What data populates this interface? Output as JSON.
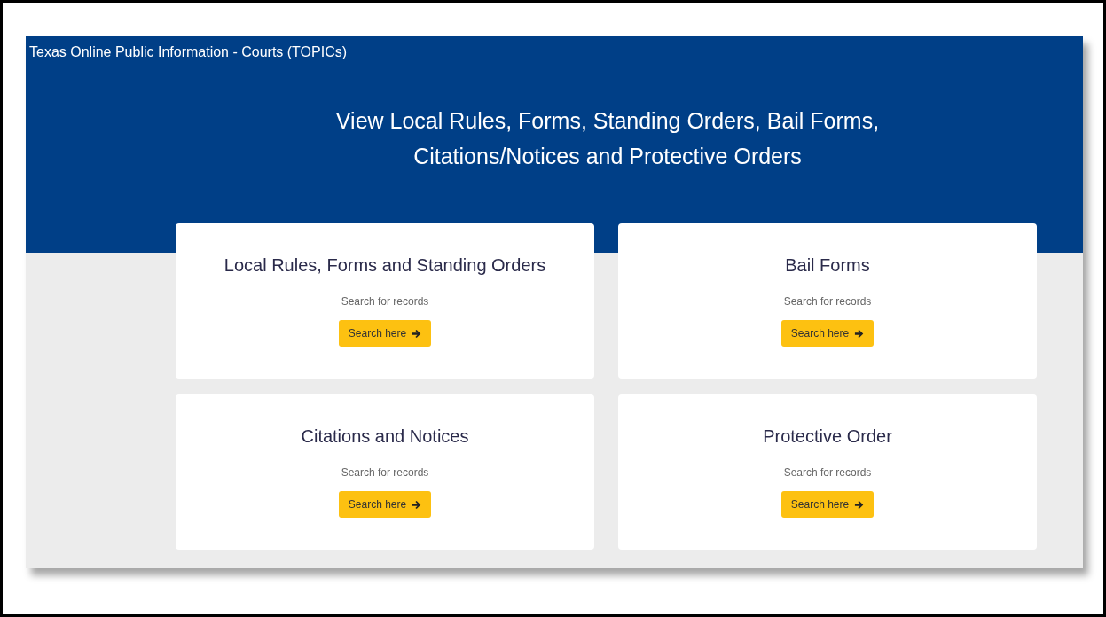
{
  "header": {
    "title": "Texas Online Public Information - Courts (TOPICs)",
    "heading": "View Local Rules, Forms, Standing Orders, Bail Forms, Citations/Notices and Protective Orders"
  },
  "cards": [
    {
      "title": "Local Rules, Forms and Standing Orders",
      "subtitle": "Search for records",
      "button": "Search here"
    },
    {
      "title": "Bail Forms",
      "subtitle": "Search for records",
      "button": "Search here"
    },
    {
      "title": "Citations and Notices",
      "subtitle": "Search for records",
      "button": "Search here"
    },
    {
      "title": "Protective Order",
      "subtitle": "Search for records",
      "button": "Search here"
    }
  ]
}
